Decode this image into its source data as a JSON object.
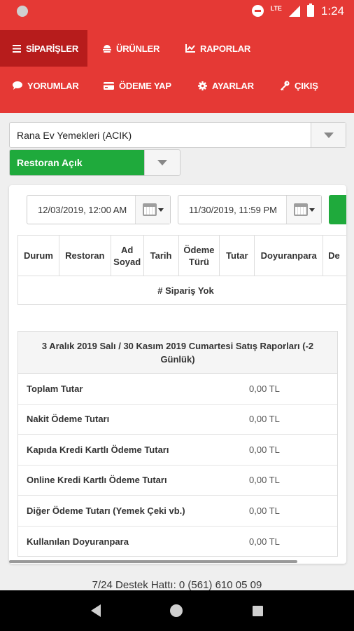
{
  "status_bar": {
    "time": "1:24",
    "network": "LTE"
  },
  "menu": {
    "items": [
      {
        "label": "SİPARİŞLER",
        "icon": "menu-icon"
      },
      {
        "label": "ÜRÜNLER",
        "icon": "food-icon"
      },
      {
        "label": "RAPORLAR",
        "icon": "chart-icon"
      },
      {
        "label": "YORUMLAR",
        "icon": "comment-icon"
      },
      {
        "label": "ÖDEME YAP",
        "icon": "credit-card-icon"
      },
      {
        "label": "AYARLAR",
        "icon": "gear-icon"
      },
      {
        "label": "ÇIKIŞ",
        "icon": "key-icon"
      }
    ]
  },
  "restaurant_select": {
    "value": "Rana Ev Yemekleri (ACIK)"
  },
  "status_select": {
    "value": "Restoran Açık",
    "color": "#1faa3c"
  },
  "filters": {
    "start_date": "12/03/2019, 12:00 AM",
    "end_date": "11/30/2019, 11:59 PM"
  },
  "orders_table": {
    "columns": [
      "Durum",
      "Restoran",
      "Ad\nSoyad",
      "Tarih",
      "Ödeme\nTürü",
      "Tutar",
      "Doyuranpara",
      "De"
    ],
    "empty_text": "# Sipariş Yok"
  },
  "report": {
    "title": "3 Aralık 2019 Salı / 30 Kasım 2019 Cumartesi Satış Raporları (-2 Günlük)",
    "rows": [
      {
        "label": "Toplam Tutar",
        "value": "0,00 TL"
      },
      {
        "label": "Nakit Ödeme Tutarı",
        "value": "0,00 TL"
      },
      {
        "label": "Kapıda Kredi Kartlı Ödeme Tutarı",
        "value": "0,00 TL"
      },
      {
        "label": "Online Kredi Kartlı Ödeme Tutarı",
        "value": "0,00 TL"
      },
      {
        "label": "Diğer Ödeme Tutarı (Yemek Çeki vb.)",
        "value": "0,00 TL"
      },
      {
        "label": "Kullanılan Doyuranpara",
        "value": "0,00 TL"
      }
    ]
  },
  "footer": {
    "support": "7/24 Destek Hattı: 0 (561) 610 05 09"
  },
  "colors": {
    "brand_red": "#e53935",
    "active_red": "#b71c1c",
    "success_green": "#1faa3c"
  }
}
